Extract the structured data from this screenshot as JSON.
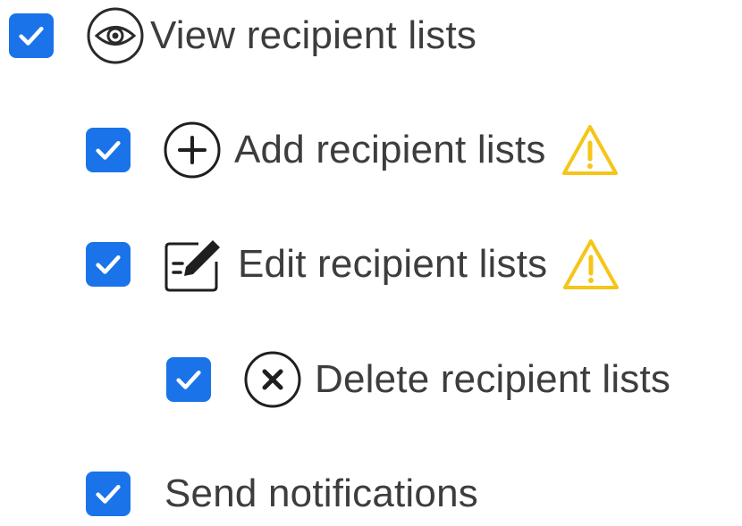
{
  "permissions": [
    {
      "label": "View recipient lists",
      "checked": true,
      "icon": "eye-icon",
      "warning": false
    },
    {
      "label": "Add recipient lists",
      "checked": true,
      "icon": "plus-circle-icon",
      "warning": true
    },
    {
      "label": "Edit recipient lists",
      "checked": true,
      "icon": "edit-icon",
      "warning": true
    },
    {
      "label": "Delete recipient lists",
      "checked": true,
      "icon": "x-circle-icon",
      "warning": false
    },
    {
      "label": "Send notifications",
      "checked": true,
      "icon": "",
      "warning": false
    }
  ],
  "colors": {
    "checkbox": "#1a73e8",
    "warning": "#f5c518",
    "text": "#3d3d3d"
  }
}
